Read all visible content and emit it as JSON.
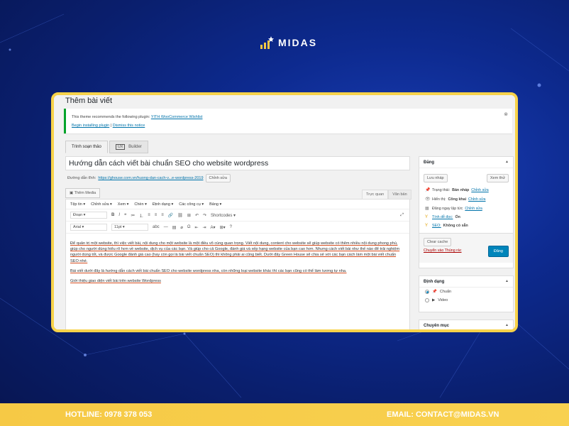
{
  "brand": {
    "name": "MIDAS"
  },
  "wp": {
    "page_title": "Thêm bài viết",
    "notice": {
      "text": "This theme recommends the following plugin:",
      "plugin_link": "YITH WooCommerce Wishlist",
      "begin_link": "Begin installing plugin",
      "separator": "|",
      "dismiss_link": "Dismiss this notice"
    },
    "mode_tabs": [
      "Trình soạn thảo",
      "Builder"
    ],
    "ux_badge": "UX",
    "post_title": "Hướng dẫn cách viết bài chuẩn SEO cho website wordpress",
    "permalink": {
      "label": "Đường dẫn tĩnh:",
      "url": "https://ghouse.com.vn/huong-dan-cach-v...e-wordpress-2019",
      "edit_button": "Chỉnh sửa"
    },
    "add_media": "Thêm Media",
    "editor_tabs": [
      "Trực quan",
      "Văn bản"
    ],
    "menubar": [
      "Tệp tin ▾",
      "Chỉnh sửa ▾",
      "Xem ▾",
      "Chèn ▾",
      "Định dạng ▾",
      "Các công cụ ▾",
      "Bảng ▾"
    ],
    "toolbar1": {
      "format_select": "Đoạn",
      "shortcodes": "Shortcodes ▾"
    },
    "toolbar2": {
      "font_select": "Arial",
      "size_select": "11pt"
    },
    "content": {
      "p1": "Để quản trị một website, thì việc viết bài, nội dung cho một website là một điều vô cùng quan trọng. Viết nội dung, content cho website sẽ giúp website có thêm nhiều nội dung phong phú, giúp cho người dùng hiểu rõ hơn về website, dịch vụ của các bạn. Và giúp cho cả Google, đánh giá và xếp hạng website của bạn cao hơn. Nhưng cách viết bài như thế nào để trải nghiệm người dùng tốt, và được Google đánh giá cao (hay còn gọi là bài viết chuẩn SEO) thì không phải ai cũng biết. Dưới đây Green House sẽ chia sẻ với các bạn cách làm một bài viết chuẩn SEO nhé.",
      "p2": "Bài viết dưới đây là hướng dẫn cách viết bài chuẩn SEO cho website wordpress nha, còn những loại website khác thì các bạn cũng có thể làm tương tự nha.",
      "p3": "Giới thiệu giao diện viết bài trên website Wordpress"
    },
    "publish_box": {
      "title": "Đăng",
      "save_draft": "Lưu nháp",
      "preview": "Xem thử",
      "status_label": "Trạng thái:",
      "status_value": "Bản nháp",
      "visibility_label": "Hiển thị:",
      "visibility_value": "Công khai",
      "schedule_text": "Đăng ngay lập tức",
      "edit_link": "Chỉnh sửa",
      "readability_link": "Tính dễ đọc:",
      "readability_value": "Ổn",
      "seo_link": "SEO:",
      "seo_value": "Không có sẵn",
      "clear_cache": "Clear cache",
      "trash_link": "Chuyển vào Thùng rác",
      "publish_button": "Đăng"
    },
    "format_box": {
      "title": "Định dạng",
      "options": [
        "Chuẩn",
        "Video"
      ]
    },
    "category_box": {
      "title": "Chuyên mục"
    }
  },
  "footer": {
    "hotline": "HOTLINE: 0978 378 053",
    "email": "EMAIL: CONTACT@MIDAS.VN"
  },
  "colors": {
    "background": "#0d2a8f",
    "frame_border": "#f7d24a",
    "footer": "#f6c945",
    "wp_link": "#0073aa",
    "publish_button": "#0085ba"
  }
}
